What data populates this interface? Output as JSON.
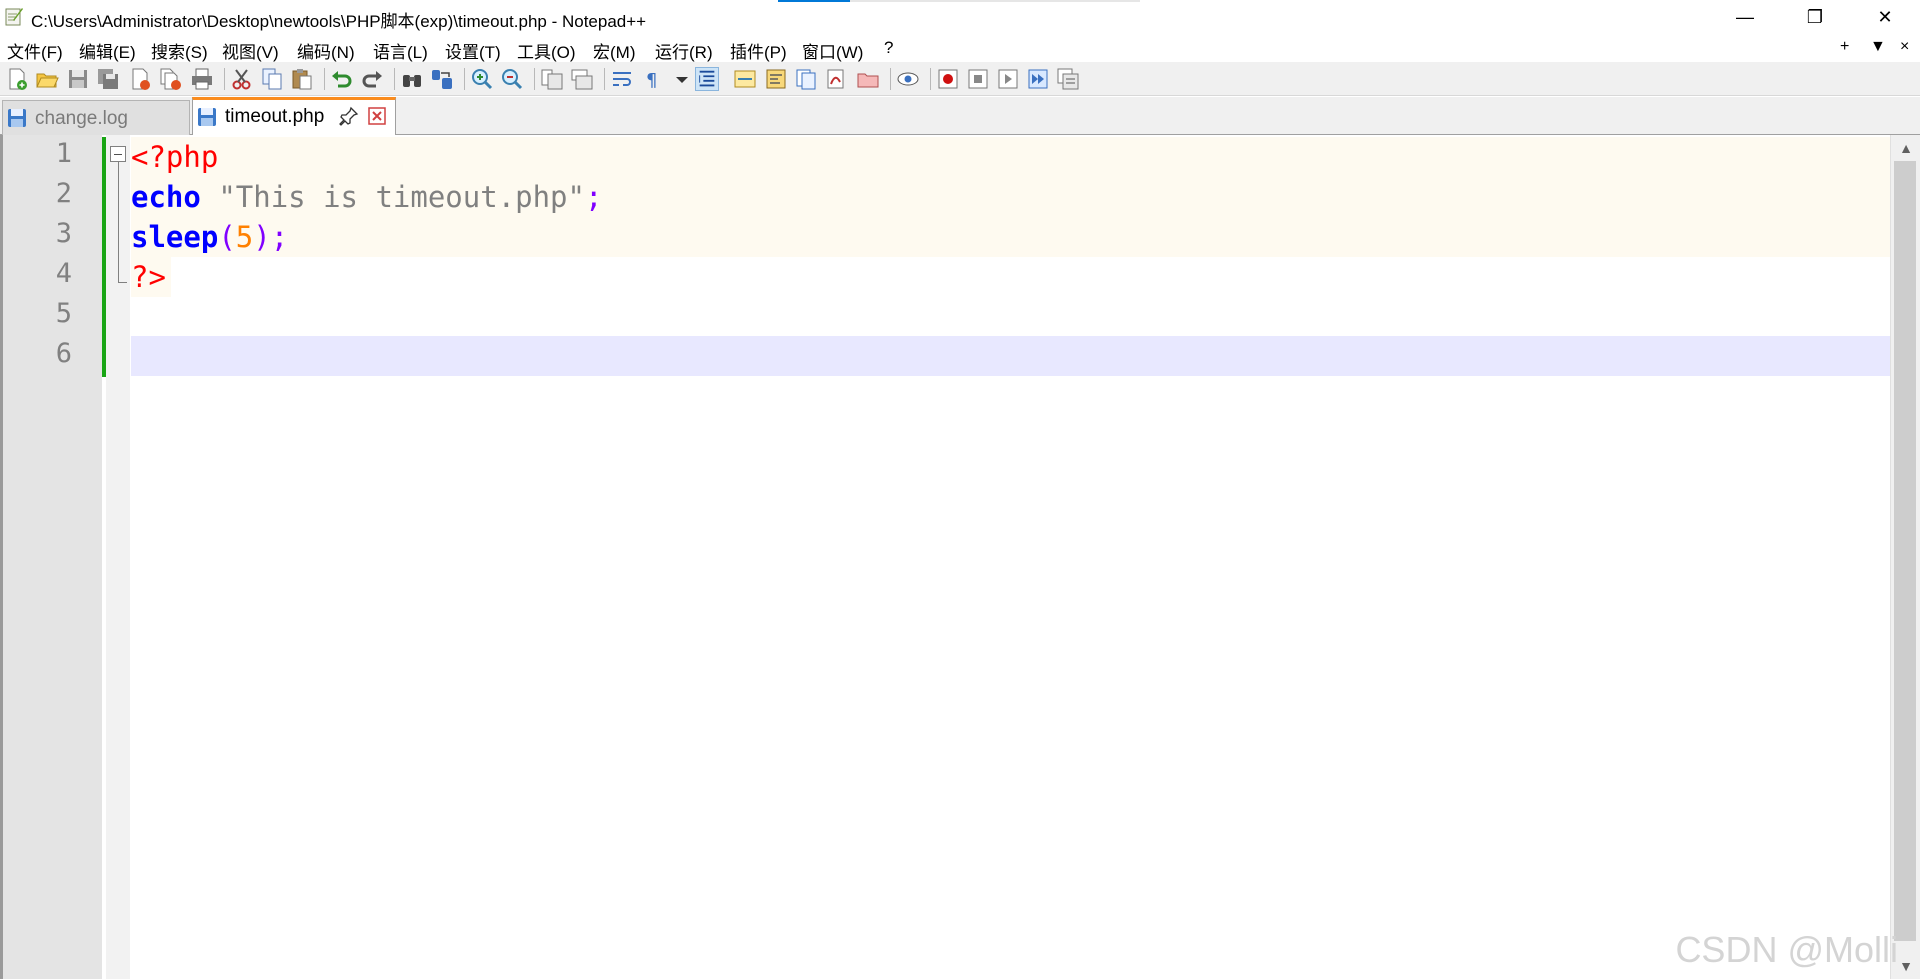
{
  "window": {
    "title": "C:\\Users\\Administrator\\Desktop\\newtools\\PHP脚本(exp)\\timeout.php - Notepad++",
    "minimize_glyph": "—",
    "maximize_glyph": "❐",
    "close_glyph": "✕"
  },
  "menu": {
    "items": [
      "文件(F)",
      "编辑(E)",
      "搜索(S)",
      "视图(V)",
      "编码(N)",
      "语言(L)",
      "设置(T)",
      "工具(O)",
      "宏(M)",
      "运行(R)",
      "插件(P)",
      "窗口(W)",
      "?"
    ],
    "right": [
      "+",
      "▼",
      "×"
    ]
  },
  "toolbar": {
    "icons": [
      "new-file-icon",
      "open-file-icon",
      "save-icon",
      "save-all-icon",
      "close-icon",
      "close-all-icon",
      "print-icon",
      "cut-icon",
      "copy-icon",
      "paste-icon",
      "undo-icon",
      "redo-icon",
      "find-icon",
      "replace-icon",
      "zoom-in-icon",
      "zoom-out-icon",
      "sync-vertical-icon",
      "sync-horizontal-icon",
      "word-wrap-icon",
      "show-all-chars-icon",
      "indent-guide-icon",
      "user-language-icon",
      "doc-map-icon",
      "function-list-icon",
      "folder-workspace-icon",
      "monitoring-icon",
      "record-macro-icon",
      "stop-macro-icon",
      "play-macro-icon",
      "run-macro-multiple-icon",
      "save-macro-icon"
    ]
  },
  "tabs": [
    {
      "label": "change.log",
      "active": false
    },
    {
      "label": "timeout.php",
      "active": true
    }
  ],
  "editor": {
    "line_numbers": [
      "1",
      "2",
      "3",
      "4",
      "5",
      "6"
    ],
    "lines": [
      [
        {
          "t": "<?php",
          "c": "tag"
        }
      ],
      [
        {
          "t": "echo",
          "c": "kw"
        },
        {
          "t": " ",
          "c": "plain"
        },
        {
          "t": "\"This is timeout.php\"",
          "c": "str"
        },
        {
          "t": ";",
          "c": "op"
        }
      ],
      [
        {
          "t": "sleep",
          "c": "kw"
        },
        {
          "t": "(",
          "c": "op"
        },
        {
          "t": "5",
          "c": "num"
        },
        {
          "t": ")",
          "c": "op"
        },
        {
          "t": ";",
          "c": "op"
        }
      ],
      [
        {
          "t": "?>",
          "c": "tag"
        }
      ],
      [],
      []
    ],
    "current_line": 6
  },
  "colors": {
    "tag": "#ff0000",
    "keyword": "#0000ff",
    "string": "#808080",
    "operator": "#8000ff",
    "number": "#ff8000",
    "change_marker": "#19a515",
    "current_line_bg": "#e8e8ff",
    "active_tab_accent": "#fa8c1e"
  },
  "watermark": "CSDN @Molli"
}
